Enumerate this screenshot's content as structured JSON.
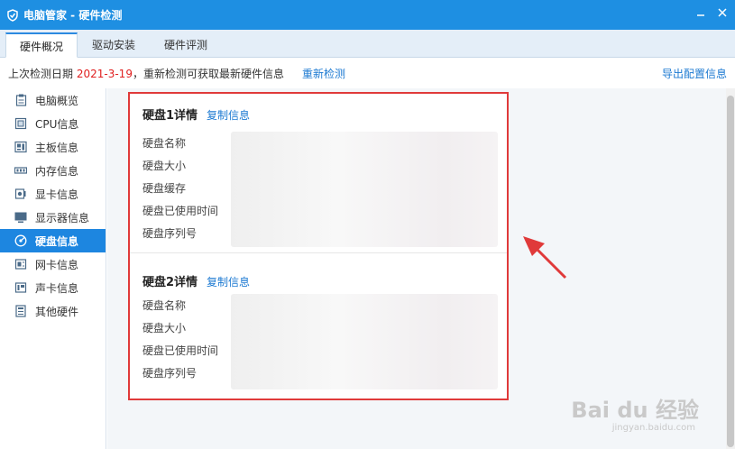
{
  "window": {
    "title": "电脑管家 - 硬件检测",
    "title_icon": "shield-icon",
    "minimize_icon": "minimize-icon",
    "close_icon": "close-icon"
  },
  "tabs": [
    {
      "label": "硬件概况",
      "active": true
    },
    {
      "label": "驱动安装",
      "active": false
    },
    {
      "label": "硬件评测",
      "active": false
    }
  ],
  "infobar": {
    "prefix": "上次检测日期",
    "date": "2021-3-19",
    "suffix": "，重新检测可获取最新硬件信息",
    "recheck": "重新检测",
    "export": "导出配置信息"
  },
  "sidebar": {
    "items": [
      {
        "label": "电脑概览",
        "icon": "clipboard-icon"
      },
      {
        "label": "CPU信息",
        "icon": "cpu-icon"
      },
      {
        "label": "主板信息",
        "icon": "motherboard-icon"
      },
      {
        "label": "内存信息",
        "icon": "memory-icon"
      },
      {
        "label": "显卡信息",
        "icon": "gpu-icon"
      },
      {
        "label": "显示器信息",
        "icon": "monitor-icon"
      },
      {
        "label": "硬盘信息",
        "icon": "disk-icon",
        "active": true
      },
      {
        "label": "网卡信息",
        "icon": "network-card-icon"
      },
      {
        "label": "声卡信息",
        "icon": "sound-card-icon"
      },
      {
        "label": "其他硬件",
        "icon": "other-hardware-icon"
      }
    ]
  },
  "disks": [
    {
      "title": "硬盘1详情",
      "copy": "复制信息",
      "labels": [
        "硬盘名称",
        "硬盘大小",
        "硬盘缓存",
        "硬盘已使用时间",
        "硬盘序列号"
      ]
    },
    {
      "title": "硬盘2详情",
      "copy": "复制信息",
      "labels": [
        "硬盘名称",
        "硬盘大小",
        "硬盘已使用时间",
        "硬盘序列号"
      ]
    }
  ],
  "watermark": {
    "text": "Bai du 经验",
    "sub": "jingyan.baidu.com"
  },
  "colors": {
    "titlebar": "#1e8fe2",
    "accent": "#1d86e0",
    "highlight_box": "#e03a3a",
    "date": "#e02020"
  }
}
